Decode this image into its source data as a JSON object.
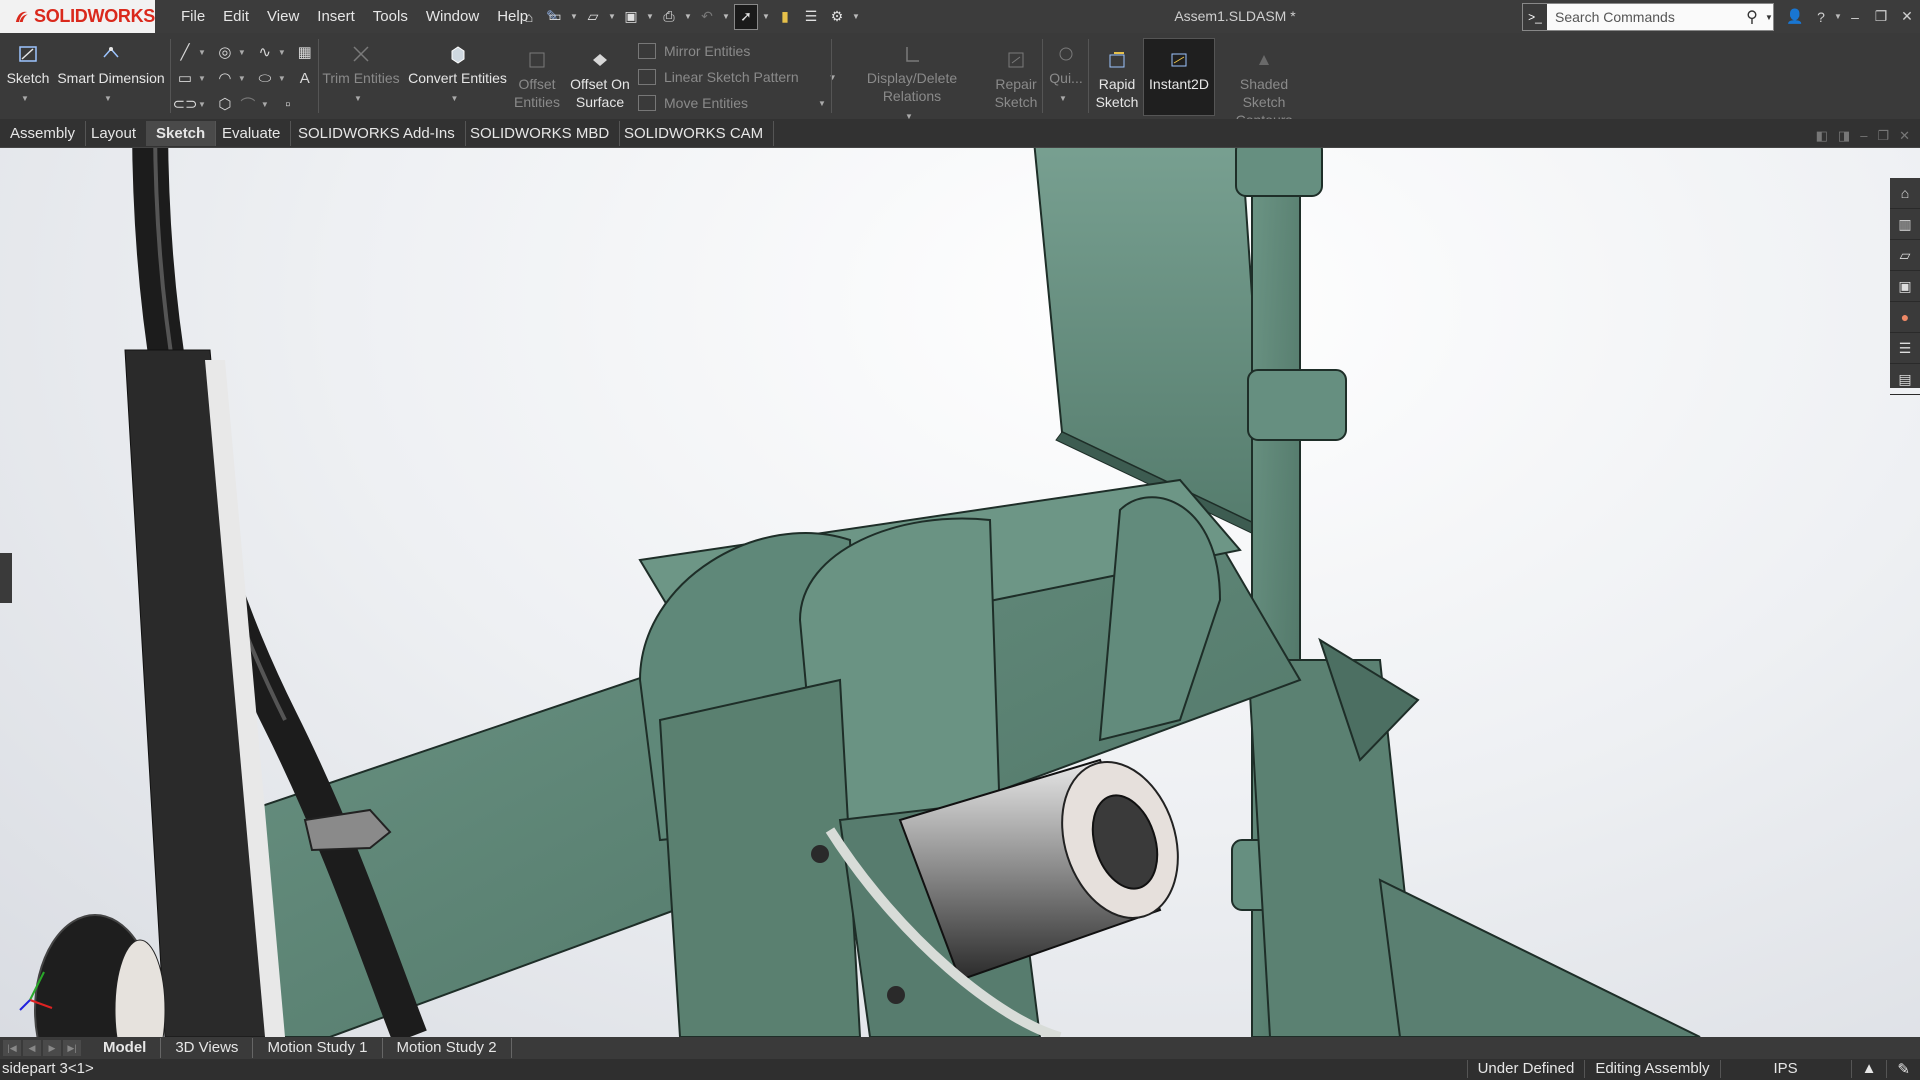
{
  "app": {
    "brand": "SOLIDWORKS",
    "document_title": "Assem1.SLDASM *"
  },
  "menu": [
    "File",
    "Edit",
    "View",
    "Insert",
    "Tools",
    "Window",
    "Help"
  ],
  "search": {
    "placeholder": "Search Commands"
  },
  "ribbon": {
    "sketch": "Sketch",
    "smart_dimension": "Smart Dimension",
    "trim_entities": "Trim Entities",
    "convert_entities": "Convert Entities",
    "offset_entities_1": "Offset",
    "offset_entities_2": "Entities",
    "offset_on_surface_1": "Offset On",
    "offset_on_surface_2": "Surface",
    "mirror_entities": "Mirror Entities",
    "linear_sketch_pattern": "Linear Sketch Pattern",
    "move_entities": "Move Entities",
    "display_delete_relations": "Display/Delete Relations",
    "repair_sketch_1": "Repair",
    "repair_sketch_2": "Sketch",
    "quick_snaps": "Qui...",
    "rapid_sketch_1": "Rapid",
    "rapid_sketch_2": "Sketch",
    "instant2d": "Instant2D",
    "shaded_sketch_contours_1": "Shaded Sketch",
    "shaded_sketch_contours_2": "Contours"
  },
  "command_tabs": [
    "Assembly",
    "Layout",
    "Sketch",
    "Evaluate",
    "SOLIDWORKS Add-Ins",
    "SOLIDWORKS MBD",
    "SOLIDWORKS CAM"
  ],
  "active_command_tab": "Sketch",
  "bottom_tabs": [
    "Model",
    "3D Views",
    "Motion Study 1",
    "Motion Study 2"
  ],
  "active_bottom_tab": "Model",
  "status": {
    "selection": "sidepart 3<1>",
    "sketch_state": "Under Defined",
    "mode": "Editing Assembly",
    "units": "IPS"
  },
  "colors": {
    "model_green": "#5f8678",
    "accent_red": "#da291c"
  }
}
